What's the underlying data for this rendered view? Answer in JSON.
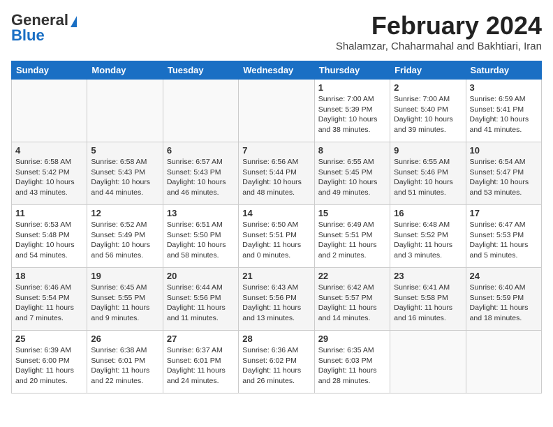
{
  "logo": {
    "line1": "General",
    "line2": "Blue"
  },
  "header": {
    "month": "February 2024",
    "location": "Shalamzar, Chaharmahal and Bakhtiari, Iran"
  },
  "weekdays": [
    "Sunday",
    "Monday",
    "Tuesday",
    "Wednesday",
    "Thursday",
    "Friday",
    "Saturday"
  ],
  "weeks": [
    [
      {
        "day": "",
        "info": ""
      },
      {
        "day": "",
        "info": ""
      },
      {
        "day": "",
        "info": ""
      },
      {
        "day": "",
        "info": ""
      },
      {
        "day": "1",
        "info": "Sunrise: 7:00 AM\nSunset: 5:39 PM\nDaylight: 10 hours\nand 38 minutes."
      },
      {
        "day": "2",
        "info": "Sunrise: 7:00 AM\nSunset: 5:40 PM\nDaylight: 10 hours\nand 39 minutes."
      },
      {
        "day": "3",
        "info": "Sunrise: 6:59 AM\nSunset: 5:41 PM\nDaylight: 10 hours\nand 41 minutes."
      }
    ],
    [
      {
        "day": "4",
        "info": "Sunrise: 6:58 AM\nSunset: 5:42 PM\nDaylight: 10 hours\nand 43 minutes."
      },
      {
        "day": "5",
        "info": "Sunrise: 6:58 AM\nSunset: 5:43 PM\nDaylight: 10 hours\nand 44 minutes."
      },
      {
        "day": "6",
        "info": "Sunrise: 6:57 AM\nSunset: 5:43 PM\nDaylight: 10 hours\nand 46 minutes."
      },
      {
        "day": "7",
        "info": "Sunrise: 6:56 AM\nSunset: 5:44 PM\nDaylight: 10 hours\nand 48 minutes."
      },
      {
        "day": "8",
        "info": "Sunrise: 6:55 AM\nSunset: 5:45 PM\nDaylight: 10 hours\nand 49 minutes."
      },
      {
        "day": "9",
        "info": "Sunrise: 6:55 AM\nSunset: 5:46 PM\nDaylight: 10 hours\nand 51 minutes."
      },
      {
        "day": "10",
        "info": "Sunrise: 6:54 AM\nSunset: 5:47 PM\nDaylight: 10 hours\nand 53 minutes."
      }
    ],
    [
      {
        "day": "11",
        "info": "Sunrise: 6:53 AM\nSunset: 5:48 PM\nDaylight: 10 hours\nand 54 minutes."
      },
      {
        "day": "12",
        "info": "Sunrise: 6:52 AM\nSunset: 5:49 PM\nDaylight: 10 hours\nand 56 minutes."
      },
      {
        "day": "13",
        "info": "Sunrise: 6:51 AM\nSunset: 5:50 PM\nDaylight: 10 hours\nand 58 minutes."
      },
      {
        "day": "14",
        "info": "Sunrise: 6:50 AM\nSunset: 5:51 PM\nDaylight: 11 hours\nand 0 minutes."
      },
      {
        "day": "15",
        "info": "Sunrise: 6:49 AM\nSunset: 5:51 PM\nDaylight: 11 hours\nand 2 minutes."
      },
      {
        "day": "16",
        "info": "Sunrise: 6:48 AM\nSunset: 5:52 PM\nDaylight: 11 hours\nand 3 minutes."
      },
      {
        "day": "17",
        "info": "Sunrise: 6:47 AM\nSunset: 5:53 PM\nDaylight: 11 hours\nand 5 minutes."
      }
    ],
    [
      {
        "day": "18",
        "info": "Sunrise: 6:46 AM\nSunset: 5:54 PM\nDaylight: 11 hours\nand 7 minutes."
      },
      {
        "day": "19",
        "info": "Sunrise: 6:45 AM\nSunset: 5:55 PM\nDaylight: 11 hours\nand 9 minutes."
      },
      {
        "day": "20",
        "info": "Sunrise: 6:44 AM\nSunset: 5:56 PM\nDaylight: 11 hours\nand 11 minutes."
      },
      {
        "day": "21",
        "info": "Sunrise: 6:43 AM\nSunset: 5:56 PM\nDaylight: 11 hours\nand 13 minutes."
      },
      {
        "day": "22",
        "info": "Sunrise: 6:42 AM\nSunset: 5:57 PM\nDaylight: 11 hours\nand 14 minutes."
      },
      {
        "day": "23",
        "info": "Sunrise: 6:41 AM\nSunset: 5:58 PM\nDaylight: 11 hours\nand 16 minutes."
      },
      {
        "day": "24",
        "info": "Sunrise: 6:40 AM\nSunset: 5:59 PM\nDaylight: 11 hours\nand 18 minutes."
      }
    ],
    [
      {
        "day": "25",
        "info": "Sunrise: 6:39 AM\nSunset: 6:00 PM\nDaylight: 11 hours\nand 20 minutes."
      },
      {
        "day": "26",
        "info": "Sunrise: 6:38 AM\nSunset: 6:01 PM\nDaylight: 11 hours\nand 22 minutes."
      },
      {
        "day": "27",
        "info": "Sunrise: 6:37 AM\nSunset: 6:01 PM\nDaylight: 11 hours\nand 24 minutes."
      },
      {
        "day": "28",
        "info": "Sunrise: 6:36 AM\nSunset: 6:02 PM\nDaylight: 11 hours\nand 26 minutes."
      },
      {
        "day": "29",
        "info": "Sunrise: 6:35 AM\nSunset: 6:03 PM\nDaylight: 11 hours\nand 28 minutes."
      },
      {
        "day": "",
        "info": ""
      },
      {
        "day": "",
        "info": ""
      }
    ]
  ]
}
